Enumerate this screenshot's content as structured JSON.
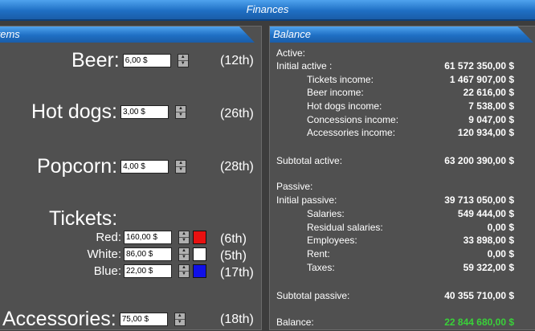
{
  "window": {
    "title": "Finances"
  },
  "items_panel": {
    "title": "Items",
    "beer": {
      "label": "Beer:",
      "price": "6,00 $",
      "rank": "(12th)"
    },
    "hot_dogs": {
      "label": "Hot dogs:",
      "price": "3,00 $",
      "rank": "(26th)"
    },
    "popcorn": {
      "label": "Popcorn:",
      "price": "4,00 $",
      "rank": "(28th)"
    },
    "tickets": {
      "label": "Tickets:",
      "red": {
        "label": "Red:",
        "price": "160,00 $",
        "rank": "(6th)",
        "color": "#e81010"
      },
      "white": {
        "label": "White:",
        "price": "86,00 $",
        "rank": "(5th)",
        "color": "#ffffff"
      },
      "blue": {
        "label": "Blue:",
        "price": "22,00 $",
        "rank": "(17th)",
        "color": "#1010e8"
      }
    },
    "accessories": {
      "label": "Accessories:",
      "price": "75,00 $",
      "rank": "(18th)"
    }
  },
  "balance_panel": {
    "title": "Balance",
    "active_heading": "Active:",
    "initial_active": {
      "label": "Initial active :",
      "value": "61 572 350,00 $"
    },
    "tickets_income": {
      "label": "Tickets income:",
      "value": "1 467 907,00 $"
    },
    "beer_income": {
      "label": "Beer income:",
      "value": "22 616,00 $"
    },
    "hotdogs_income": {
      "label": "Hot dogs income:",
      "value": "7 538,00 $"
    },
    "concessions_income": {
      "label": "Concessions income:",
      "value": "9 047,00 $"
    },
    "accessories_income": {
      "label": "Accessories income:",
      "value": "120 934,00 $"
    },
    "subtotal_active": {
      "label": "Subtotal active:",
      "value": "63 200 390,00 $"
    },
    "passive_heading": "Passive:",
    "initial_passive": {
      "label": "Initial passive:",
      "value": "39 713 050,00 $"
    },
    "salaries": {
      "label": "Salaries:",
      "value": "549 444,00 $"
    },
    "residual_salaries": {
      "label": "Residual salaries:",
      "value": "0,00 $"
    },
    "employees": {
      "label": "Employees:",
      "value": "33 898,00 $"
    },
    "rent": {
      "label": "Rent:",
      "value": "0,00 $"
    },
    "taxes": {
      "label": "Taxes:",
      "value": "59 322,00 $"
    },
    "subtotal_passive": {
      "label": "Subtotal passive:",
      "value": "40 355 710,00 $"
    },
    "balance": {
      "label": "Balance:",
      "value": "22 844 680,00 $",
      "color": "#39d139"
    }
  }
}
